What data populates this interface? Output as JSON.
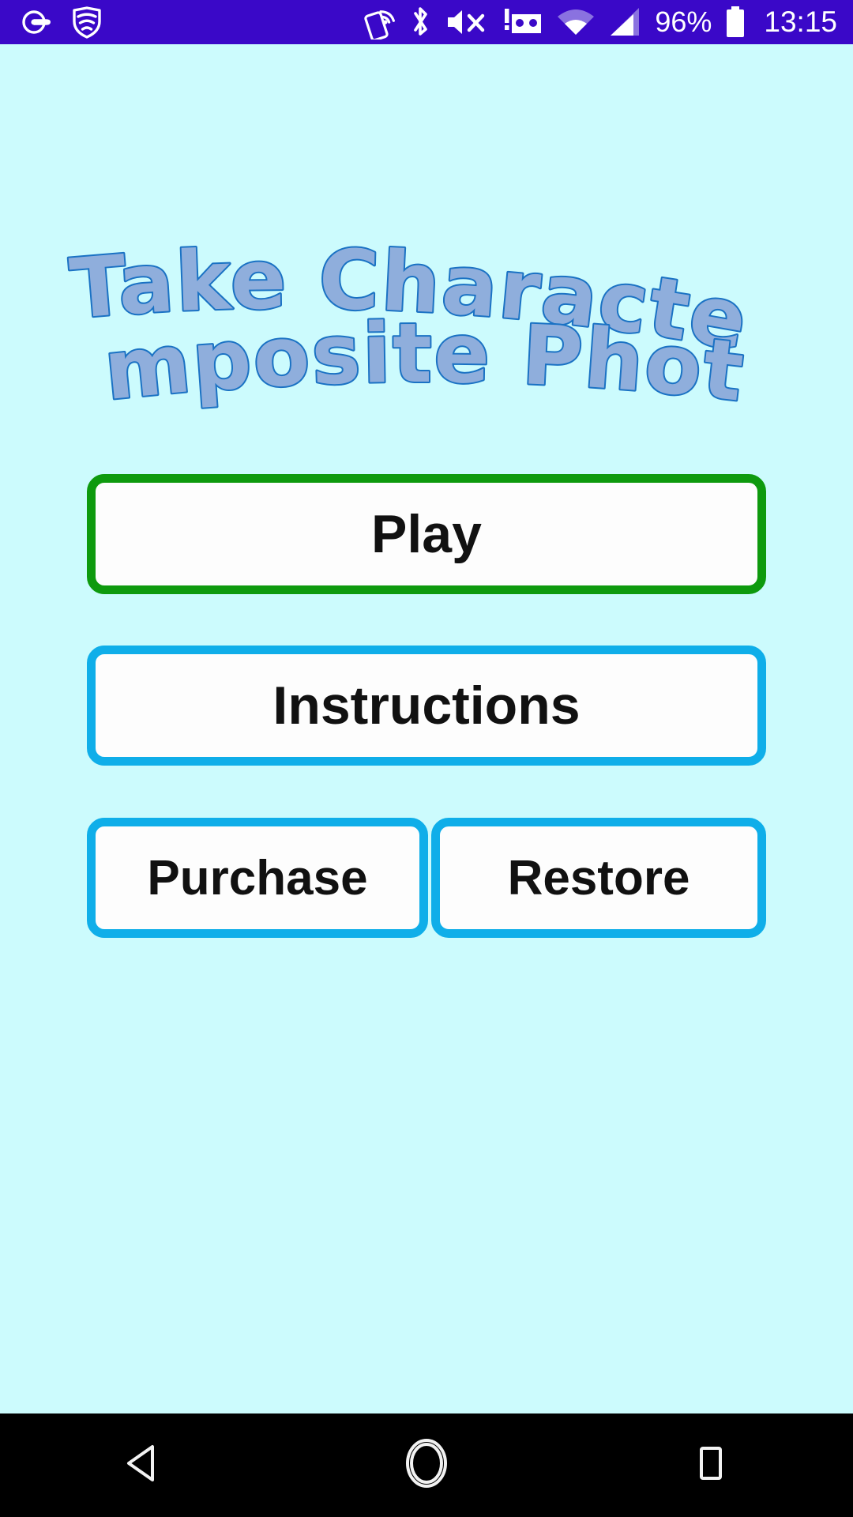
{
  "status_bar": {
    "background_color": "#3A08C8",
    "left_icons": [
      {
        "name": "call-forward-icon",
        "label": "call forwarding"
      },
      {
        "name": "vpn-shield-icon",
        "label": "secure wifi shield"
      }
    ],
    "right_icons": [
      {
        "name": "nfc-icon",
        "label": "nfc active"
      },
      {
        "name": "bluetooth-icon",
        "label": "bluetooth"
      },
      {
        "name": "volume-mute-icon",
        "label": "ringer muted"
      },
      {
        "name": "screencast-alert-icon",
        "label": "cast device alert"
      },
      {
        "name": "wifi-icon",
        "label": "wifi signal"
      },
      {
        "name": "cell-signal-icon",
        "label": "mobile signal"
      }
    ],
    "battery_percent": "96%",
    "battery_icon": "battery-full-icon",
    "clock": "13:15"
  },
  "title": {
    "line1": "Take Character",
    "line2": "Composite Photos",
    "fill_color": "#8FAEDC",
    "outline_color": "#1A72C4"
  },
  "buttons": {
    "play": {
      "label": "Play",
      "border_color": "#0E9A0E",
      "fill_color": "#FDFDFD"
    },
    "instructions": {
      "label": "Instructions",
      "border_color": "#0FAEE9",
      "fill_color": "#FDFDFD"
    },
    "purchase": {
      "label": "Purchase",
      "border_color": "#0FAEE9",
      "fill_color": "#FDFDFD"
    },
    "restore": {
      "label": "Restore",
      "border_color": "#0FAEE9",
      "fill_color": "#FDFDFD"
    }
  },
  "page": {
    "background_color": "#CCFBFD"
  },
  "nav_bar": {
    "background_color": "#000000",
    "items": [
      {
        "name": "back-button",
        "icon": "triangle-left-icon"
      },
      {
        "name": "home-button",
        "icon": "circle-icon"
      },
      {
        "name": "recents-button",
        "icon": "square-icon"
      }
    ]
  }
}
